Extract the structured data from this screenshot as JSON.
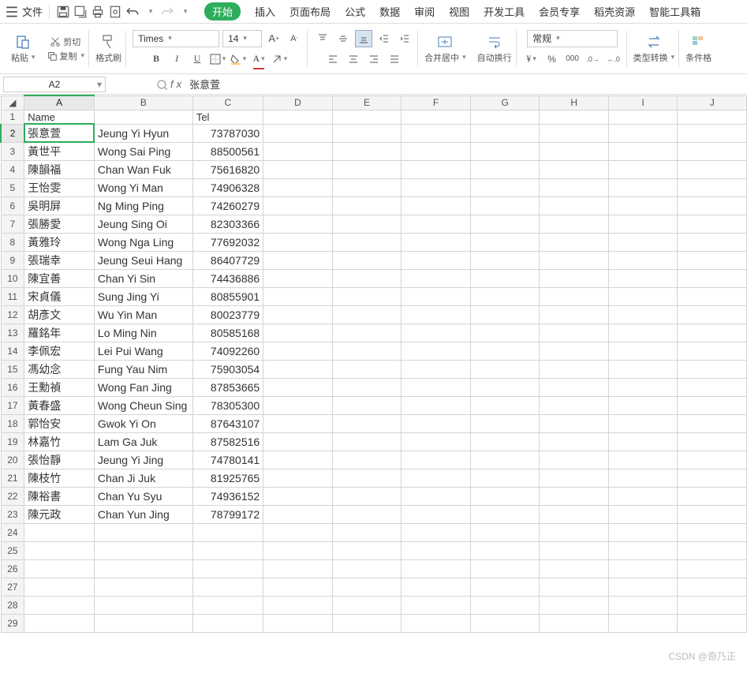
{
  "menu": {
    "file": "文件",
    "tabs": [
      "开始",
      "插入",
      "页面布局",
      "公式",
      "数据",
      "审阅",
      "视图",
      "开发工具",
      "会员专享",
      "稻壳资源",
      "智能工具箱"
    ],
    "active_index": 0
  },
  "ribbon": {
    "paste": "粘贴",
    "cut": "剪切",
    "copy": "复制",
    "format_painter": "格式刷",
    "font_name": "Times",
    "font_size": "14",
    "merge_center": "合并居中",
    "auto_wrap": "自动换行",
    "number_format": "常规",
    "type_convert": "类型转换",
    "cond_fmt": "条件格"
  },
  "namebox": "A2",
  "fx_value": "张意萱",
  "col_headers": [
    "A",
    "B",
    "C",
    "D",
    "E",
    "F",
    "G",
    "H",
    "I",
    "J"
  ],
  "header_row": {
    "a": "Name",
    "c": "Tel"
  },
  "rows": [
    {
      "n": "2",
      "a": "張意萱",
      "b": "Jeung Yi Hyun",
      "c": "73787030"
    },
    {
      "n": "3",
      "a": "黃世平",
      "b": "Wong Sai Ping",
      "c": "88500561"
    },
    {
      "n": "4",
      "a": "陳韻福",
      "b": "Chan Wan Fuk",
      "c": "75616820"
    },
    {
      "n": "5",
      "a": "王怡雯",
      "b": "Wong Yi Man",
      "c": "74906328"
    },
    {
      "n": "6",
      "a": "吳明屏",
      "b": "Ng Ming Ping",
      "c": "74260279"
    },
    {
      "n": "7",
      "a": "張勝愛",
      "b": "Jeung Sing Oi",
      "c": "82303366"
    },
    {
      "n": "8",
      "a": "黃雅玲",
      "b": "Wong Nga Ling",
      "c": "77692032"
    },
    {
      "n": "9",
      "a": "張瑞幸",
      "b": "Jeung Seui Hang",
      "c": "86407729"
    },
    {
      "n": "10",
      "a": "陳宜善",
      "b": "Chan Yi Sin",
      "c": "74436886"
    },
    {
      "n": "11",
      "a": "宋貞儀",
      "b": "Sung Jing Yi",
      "c": "80855901"
    },
    {
      "n": "12",
      "a": "胡彥文",
      "b": "Wu Yin Man",
      "c": "80023779"
    },
    {
      "n": "13",
      "a": "羅銘年",
      "b": "Lo Ming Nin",
      "c": "80585168"
    },
    {
      "n": "14",
      "a": "李佩宏",
      "b": "Lei Pui Wang",
      "c": "74092260"
    },
    {
      "n": "15",
      "a": "馮幼念",
      "b": "Fung Yau Nim",
      "c": "75903054"
    },
    {
      "n": "16",
      "a": "王勳禎",
      "b": "Wong Fan Jing",
      "c": "87853665"
    },
    {
      "n": "17",
      "a": "黃春盛",
      "b": "Wong Cheun Sing",
      "c": "78305300"
    },
    {
      "n": "18",
      "a": "郭怡安",
      "b": "Gwok Yi On",
      "c": "87643107"
    },
    {
      "n": "19",
      "a": "林嘉竹",
      "b": "Lam Ga Juk",
      "c": "87582516"
    },
    {
      "n": "20",
      "a": "張怡靜",
      "b": "Jeung Yi Jing",
      "c": "74780141"
    },
    {
      "n": "21",
      "a": "陳枝竹",
      "b": "Chan Ji Juk",
      "c": "81925765"
    },
    {
      "n": "22",
      "a": "陳裕書",
      "b": "Chan Yu Syu",
      "c": "74936152"
    },
    {
      "n": "23",
      "a": "陳元政",
      "b": "Chan Yun Jing",
      "c": "78799172"
    }
  ],
  "empty_rows": [
    "24",
    "25",
    "26",
    "27",
    "28",
    "29"
  ],
  "watermark": "CSDN @奇乃正"
}
